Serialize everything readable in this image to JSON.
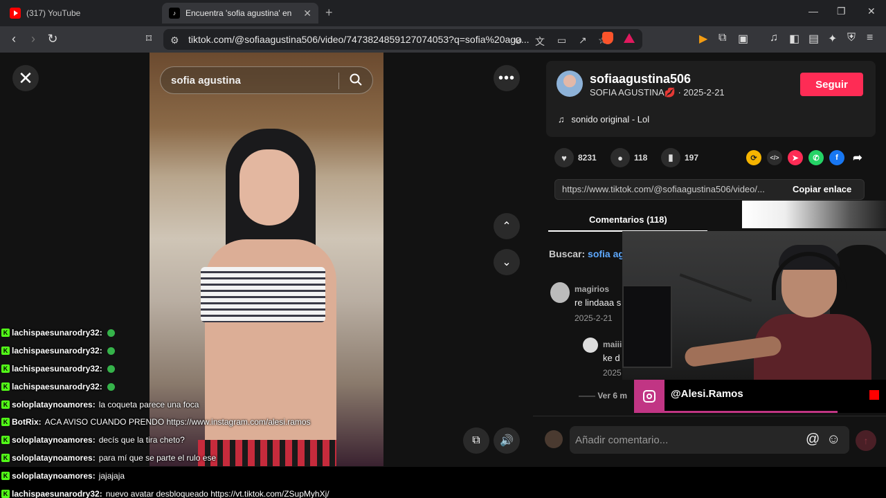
{
  "browser": {
    "tabs": [
      {
        "label": "(317) YouTube",
        "favicon": "youtube-icon"
      },
      {
        "label": "Encuentra 'sofia agustina' en",
        "favicon": "tiktok-icon"
      }
    ],
    "url": "tiktok.com/@sofiaagustina506/video/7473824859127074053?q=sofia%20agu..."
  },
  "video": {
    "search_text": "sofia agustina"
  },
  "post": {
    "username": "sofiaagustina506",
    "display_name": "SOFIA AGUSTINA💋",
    "date": "· 2025-2-21",
    "follow_label": "Seguir",
    "sound": "sonido original - Lol",
    "likes": "8231",
    "comments": "118",
    "saves": "197",
    "link": "https://www.tiktok.com/@sofiaagustina506/video/...",
    "copy_label": "Copiar enlace",
    "comments_tab": "Comentarios (118)",
    "search_label": "Buscar:",
    "search_term": "sofia ag",
    "comment_list": [
      {
        "name": "magirios",
        "text": "re lindaaa s",
        "date": "2025-2-21"
      },
      {
        "name": "maiii",
        "text": "ke d",
        "date": "2025"
      }
    ],
    "view_more": "Ver 6 m",
    "add_comment_placeholder": "Añadir comentario..."
  },
  "stream": {
    "instagram_handle": "@Alesi.Ramos",
    "accent": "#c13584"
  },
  "chat": [
    {
      "user": "lachispaesunarodry32:",
      "msg": "",
      "emote": true
    },
    {
      "user": "lachispaesunarodry32:",
      "msg": "",
      "emote": true
    },
    {
      "user": "lachispaesunarodry32:",
      "msg": "",
      "emote": true
    },
    {
      "user": "lachispaesunarodry32:",
      "msg": "",
      "emote": true
    },
    {
      "user": "soloplataynoamores:",
      "msg": "la coqueta parece una foca",
      "emote": false
    },
    {
      "user": "BotRix:",
      "msg": "ACA AVISO CUANDO PRENDO https://www.instagram.com/alesi.ramos",
      "emote": false
    },
    {
      "user": "soloplataynoamores:",
      "msg": "decís que la tira cheto?",
      "emote": false
    },
    {
      "user": "soloplataynoamores:",
      "msg": "para mí que se parte el rulo ese",
      "emote": false
    },
    {
      "user": "soloplataynoamores:",
      "msg": "jajajaja",
      "emote": false
    },
    {
      "user": "lachispaesunarodry32:",
      "msg": "nuevo avatar desbloqueado https://vt.tiktok.com/ZSupMyhXj/",
      "emote": false
    }
  ]
}
